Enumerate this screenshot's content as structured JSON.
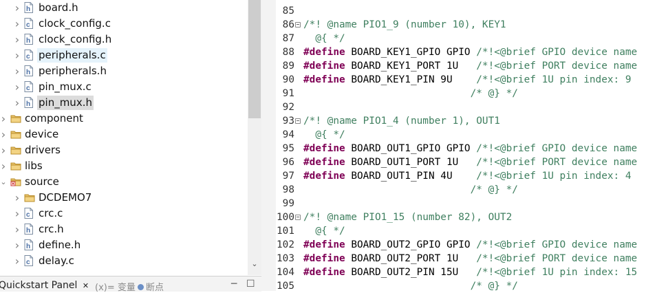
{
  "tree": {
    "items": [
      {
        "label": "board.h",
        "type": "h",
        "expand": "closed",
        "indent": 1
      },
      {
        "label": "clock_config.c",
        "type": "c",
        "expand": "closed",
        "indent": 1
      },
      {
        "label": "clock_config.h",
        "type": "h",
        "expand": "closed",
        "indent": 1
      },
      {
        "label": "peripherals.c",
        "type": "c",
        "expand": "closed",
        "indent": 1,
        "state": "hover"
      },
      {
        "label": "peripherals.h",
        "type": "h",
        "expand": "closed",
        "indent": 1
      },
      {
        "label": "pin_mux.c",
        "type": "c",
        "expand": "closed",
        "indent": 1
      },
      {
        "label": "pin_mux.h",
        "type": "h",
        "expand": "closed",
        "indent": 1,
        "state": "selected"
      },
      {
        "label": "component",
        "type": "folder",
        "expand": "closed",
        "indent": 0
      },
      {
        "label": "device",
        "type": "folder",
        "expand": "closed",
        "indent": 0
      },
      {
        "label": "drivers",
        "type": "folder",
        "expand": "closed",
        "indent": 0
      },
      {
        "label": "libs",
        "type": "folder",
        "expand": "closed",
        "indent": 0
      },
      {
        "label": "source",
        "type": "srcfolder",
        "expand": "open",
        "indent": 0
      },
      {
        "label": "DCDEMO7",
        "type": "folder",
        "expand": "closed",
        "indent": 1
      },
      {
        "label": "crc.c",
        "type": "c",
        "expand": "closed",
        "indent": 1
      },
      {
        "label": "crc.h",
        "type": "h",
        "expand": "closed",
        "indent": 1
      },
      {
        "label": "define.h",
        "type": "h",
        "expand": "closed",
        "indent": 1
      },
      {
        "label": "delay.c",
        "type": "c",
        "expand": "closed",
        "indent": 1
      }
    ]
  },
  "bottom_panel": {
    "tab_active": "Quickstart Panel",
    "close_glyph": "✕",
    "tab_variables": "(x)= 变量",
    "tab_breakpoints": "断点",
    "minimize_glyph": "─",
    "maximize_glyph": "☐"
  },
  "editor": {
    "lines": [
      {
        "n": "85",
        "text": "",
        "fold": false
      },
      {
        "n": "86",
        "text": "/*! @name PIO1_9 (number 10), KEY1",
        "fold": true
      },
      {
        "n": "87",
        "text": "  @{ */",
        "fold": false
      },
      {
        "n": "88",
        "text": "#define BOARD_KEY1_GPIO GPIO /*!<@brief GPIO device name",
        "fold": false
      },
      {
        "n": "89",
        "text": "#define BOARD_KEY1_PORT 1U   /*!<@brief PORT device name",
        "fold": false
      },
      {
        "n": "90",
        "text": "#define BOARD_KEY1_PIN 9U    /*!<@brief 1U pin index: 9",
        "fold": false
      },
      {
        "n": "91",
        "text": "                            /* @} */",
        "fold": false
      },
      {
        "n": "92",
        "text": "",
        "fold": false
      },
      {
        "n": "93",
        "text": "/*! @name PIO1_4 (number 1), OUT1",
        "fold": true
      },
      {
        "n": "94",
        "text": "  @{ */",
        "fold": false
      },
      {
        "n": "95",
        "text": "#define BOARD_OUT1_GPIO GPIO /*!<@brief GPIO device name",
        "fold": false
      },
      {
        "n": "96",
        "text": "#define BOARD_OUT1_PORT 1U   /*!<@brief PORT device name",
        "fold": false
      },
      {
        "n": "97",
        "text": "#define BOARD_OUT1_PIN 4U    /*!<@brief 1U pin index: 4",
        "fold": false
      },
      {
        "n": "98",
        "text": "                            /* @} */",
        "fold": false
      },
      {
        "n": "99",
        "text": "",
        "fold": false
      },
      {
        "n": "100",
        "text": "/*! @name PIO1_15 (number 82), OUT2",
        "fold": true
      },
      {
        "n": "101",
        "text": "  @{ */",
        "fold": false
      },
      {
        "n": "102",
        "text": "#define BOARD_OUT2_GPIO GPIO /*!<@brief GPIO device name",
        "fold": false
      },
      {
        "n": "103",
        "text": "#define BOARD_OUT2_PORT 1U   /*!<@brief PORT device name",
        "fold": false
      },
      {
        "n": "104",
        "text": "#define BOARD_OUT2_PIN 15U   /*!<@brief 1U pin index: 15",
        "fold": false
      },
      {
        "n": "105",
        "text": "                            /* @} */",
        "fold": false
      }
    ],
    "colors": {
      "comment": "#3f7f5f",
      "keyword": "#7f0055",
      "text": "#000000"
    }
  },
  "icons": {
    "closed_arrow": "chevron-right-icon",
    "open_arrow": "chevron-down-icon",
    "folder": "folder-icon",
    "source_folder": "source-folder-icon",
    "c_file": "c-file-icon",
    "h_file": "h-file-icon"
  }
}
